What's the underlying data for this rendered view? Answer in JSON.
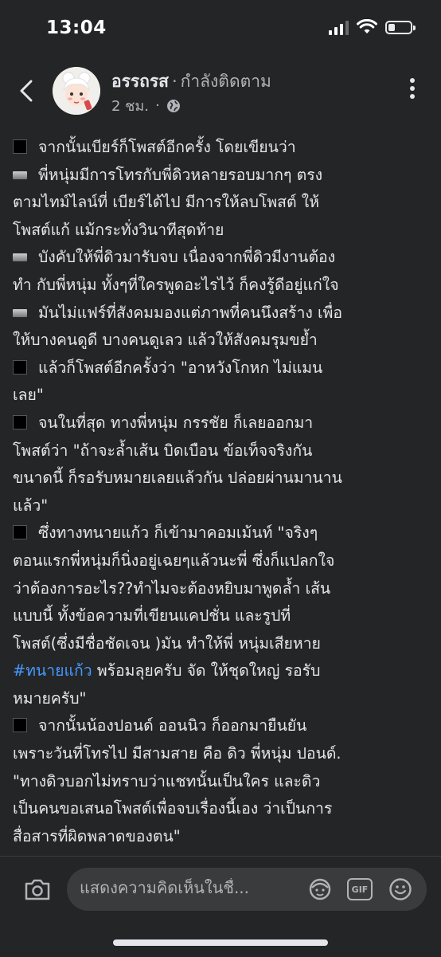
{
  "status": {
    "time": "13:04"
  },
  "header": {
    "name": "อรรถรส",
    "separator": "·",
    "follow_status": "กำลังติดตาม",
    "time_ago": "2 ชม.",
    "meta_separator": "·"
  },
  "post": {
    "lines": [
      {
        "marker": "square",
        "text": "จากนั้นเบียร์ก็โพสต์อีกครั้ง โดยเขียนว่า"
      },
      {
        "marker": "bar",
        "text": "พี่หนุ่มมีการโทรกับพี่ดิวหลายรอบมากๆ ตรง"
      },
      {
        "marker": "",
        "text": "ตามไทม์ไลน์ที่ เบียร์ได้ไป มีการให้ลบโพสต์ ให้"
      },
      {
        "marker": "",
        "text": "โพสต์แก้ แม้กระทั่งวินาทีสุดท้าย"
      },
      {
        "marker": "bar",
        "text": "บังคับให้พี่ดิวมารับจบ เนื่องจากพี่ดิวมีงานต้อง"
      },
      {
        "marker": "",
        "text": "ทำ กับพี่หนุ่ม ทั้งๆที่ใครพูดอะไรไว้ ก็คงรู้ดีอยู่แก่ใจ"
      },
      {
        "marker": "bar",
        "text": "มันไม่แฟร์ที่สังคมมองแต่ภาพที่คนนึงสร้าง เพื่อ"
      },
      {
        "marker": "",
        "text": "ให้บางคนดูดี บางคนดูเลว แล้วให้สังคมรุมขย้ำ"
      },
      {
        "marker": "square",
        "text": "แล้วก็โพสต์อีกครั้งว่า \"อาหวังโกหก ไม่แมน"
      },
      {
        "marker": "",
        "text": "เลย\""
      },
      {
        "marker": "square",
        "text": "จนในที่สุด ทางพี่หนุ่ม กรรชัย ก็เลยออกมา"
      },
      {
        "marker": "",
        "text": "โพสต์ว่า \"ถ้าจะล้ำเส้น บิดเบือน ข้อเท็จจริงกัน"
      },
      {
        "marker": "",
        "text": "ขนาดนี้ ก็รอรับหมายเลยแล้วกัน ปล่อยผ่านมานาน"
      },
      {
        "marker": "",
        "text": "แล้ว\""
      },
      {
        "marker": "square",
        "text": "ซึ่งทางทนายแก้ว ก็เข้ามาคอมเม้นท์  \"จริงๆ"
      },
      {
        "marker": "",
        "text": "ตอนแรกพี่หนุ่มก็นิ่งอยู่เฉยๆแล้วนะพี่  ซึ่งก็แปลกใจ"
      },
      {
        "marker": "",
        "text": "ว่าต้องการอะไร??ทำไมจะต้องหยิบมาพูดล้ำ เส้น"
      },
      {
        "marker": "",
        "text": "แบบนี้ ทั้งข้อความที่เขียนแคปชั่น และรูปที่"
      },
      {
        "marker": "",
        "text": "โพสต์(ซึ่งมีชื่อชัดเจน )มัน ทำให้พี่ หนุ่มเสียหาย"
      },
      {
        "marker": "",
        "text": "",
        "hashtag": "#ทนายแก้ว",
        "after": " พร้อมลุยครับ จัด ให้ชุดใหญ่ รอรับ"
      },
      {
        "marker": "",
        "text": "หมายครับ\""
      },
      {
        "marker": "square",
        "text": "จากนั้นน้องปอนด์ ออนนิว ก็ออกมายืนยัน"
      },
      {
        "marker": "",
        "text": "เพราะวันที่โทรไป มีสามสาย คือ ดิว พี่หนุ่ม ปอนด์."
      },
      {
        "marker": "",
        "text": "\"ทางดิวบอกไม่ทราบว่าแชทนั้นเป็นใคร และดิว"
      },
      {
        "marker": "",
        "text": "เป็นคนขอเสนอโพสต์เพื่อจบเรื่องนี้เอง ว่าเป็นการ"
      },
      {
        "marker": "",
        "text": "สื่อสารที่ผิดพลาดของตน\""
      }
    ]
  },
  "comment": {
    "placeholder": "แสดงความคิดเห็นในชื่...",
    "gif_label": "GIF"
  },
  "colors": {
    "background": "#242526",
    "hashtag": "#4599ff",
    "input_bg": "#3a3b3c"
  }
}
